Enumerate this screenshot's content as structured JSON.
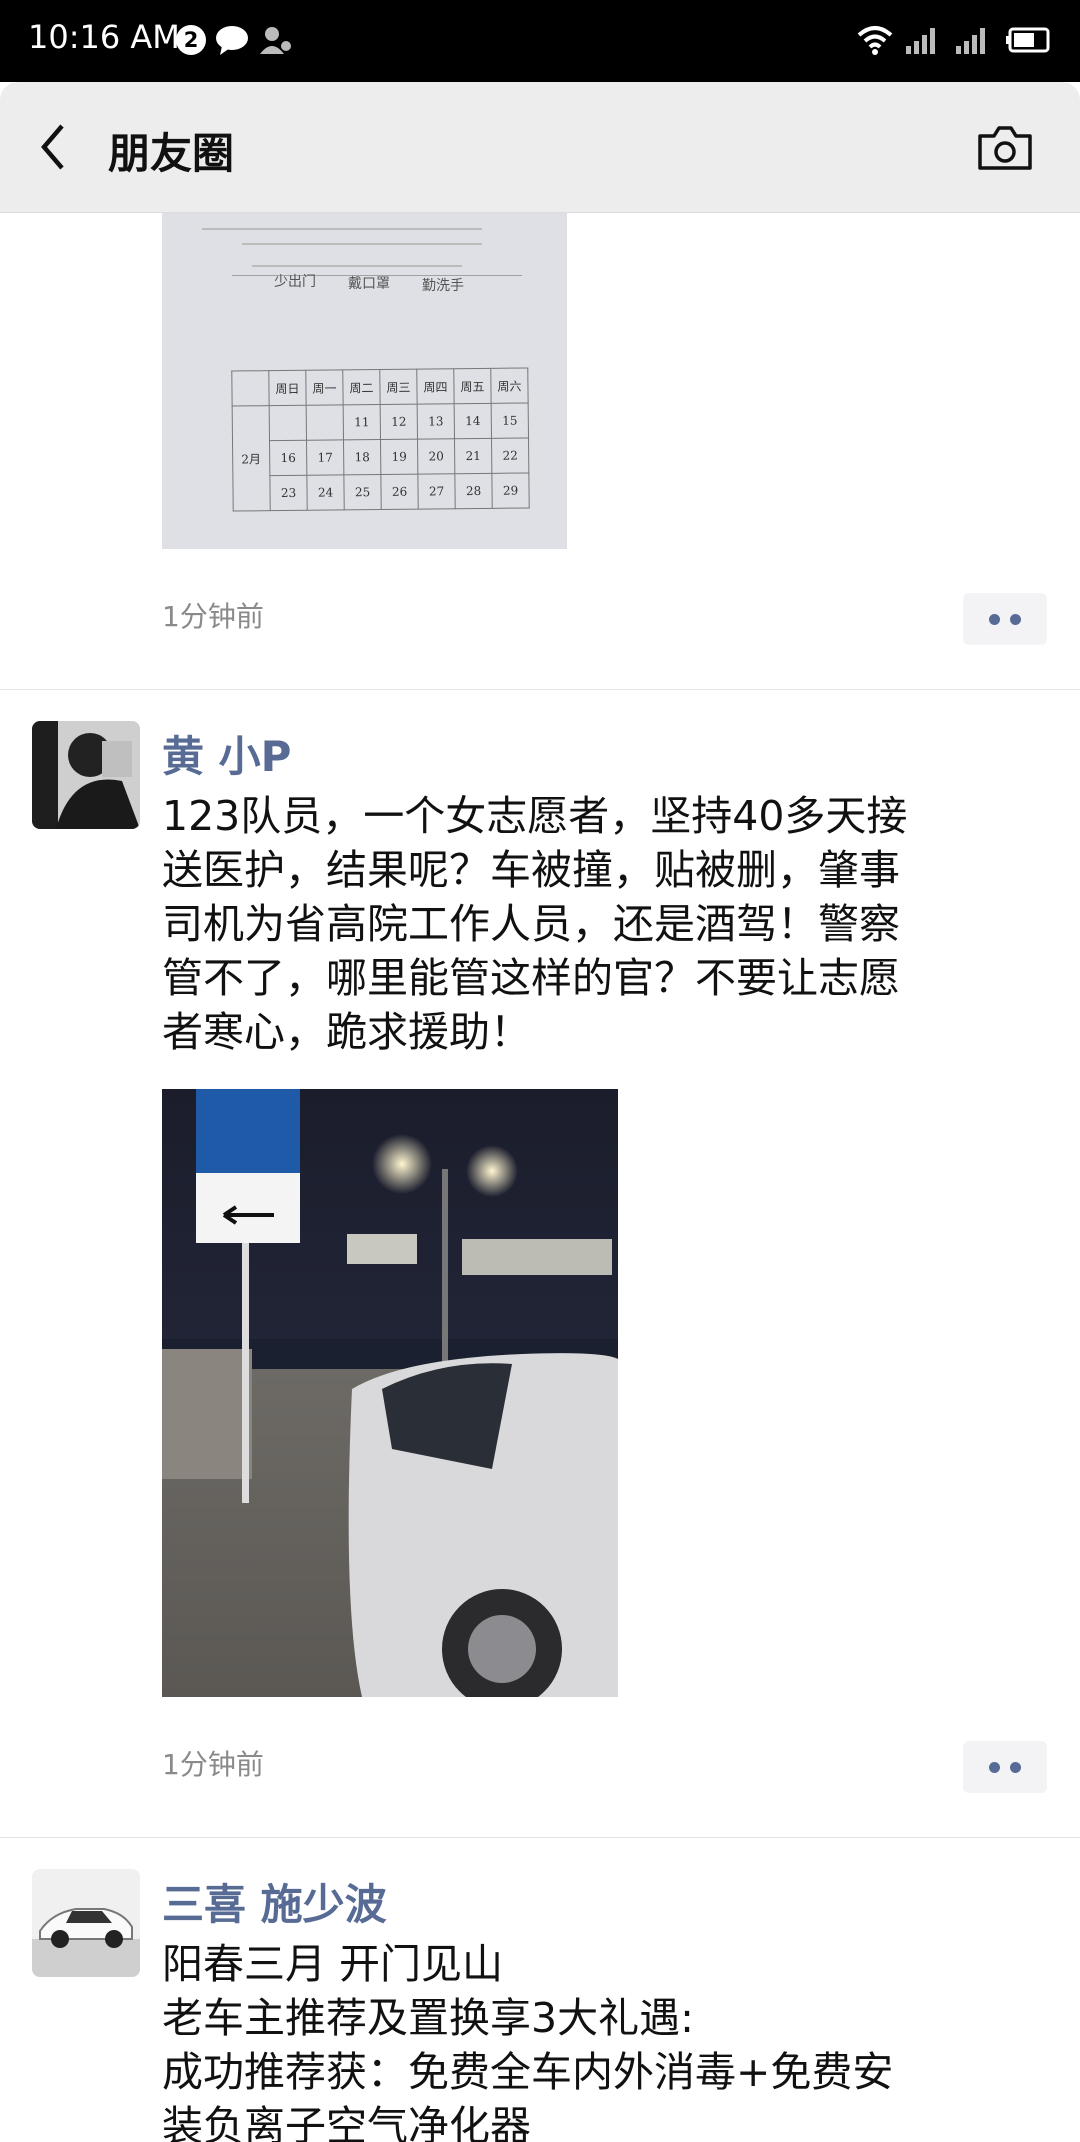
{
  "status_bar": {
    "time": "10:16 AM",
    "badge_count": "2"
  },
  "header": {
    "title": "朋友圈",
    "back_icon": "chevron-left-icon",
    "camera_icon": "camera-icon"
  },
  "posts": [
    {
      "time": "1分钟前",
      "image": {
        "words": [
          "少出门",
          "戴口罩",
          "勤洗手"
        ],
        "calendar": {
          "headers": [
            "周日",
            "周一",
            "周二",
            "周三",
            "周四",
            "周五",
            "周六"
          ],
          "month": "2月",
          "rows": [
            [
              "",
              "",
              "11",
              "12",
              "13",
              "14",
              "15"
            ],
            [
              "16",
              "17",
              "18",
              "19",
              "20",
              "21",
              "22"
            ],
            [
              "23",
              "24",
              "25",
              "26",
              "27",
              "28",
              "29"
            ]
          ]
        }
      }
    },
    {
      "author": "黄 小P",
      "text": "123队员，一个女志愿者，坚持40多天接\n送医护，结果呢？车被撞，贴被删，肇事\n司机为省高院工作人员，还是酒驾！警察\n管不了，哪里能管这样的官？不要让志愿\n者寒心，跪求援助！",
      "time": "1分钟前"
    },
    {
      "author": "三喜 施少波",
      "text": "阳春三月 开门见山\n老车主推荐及置换享3大礼遇:\n成功推荐获：免费全车内外消毒+免费安\n装负离子空气净化器"
    }
  ]
}
